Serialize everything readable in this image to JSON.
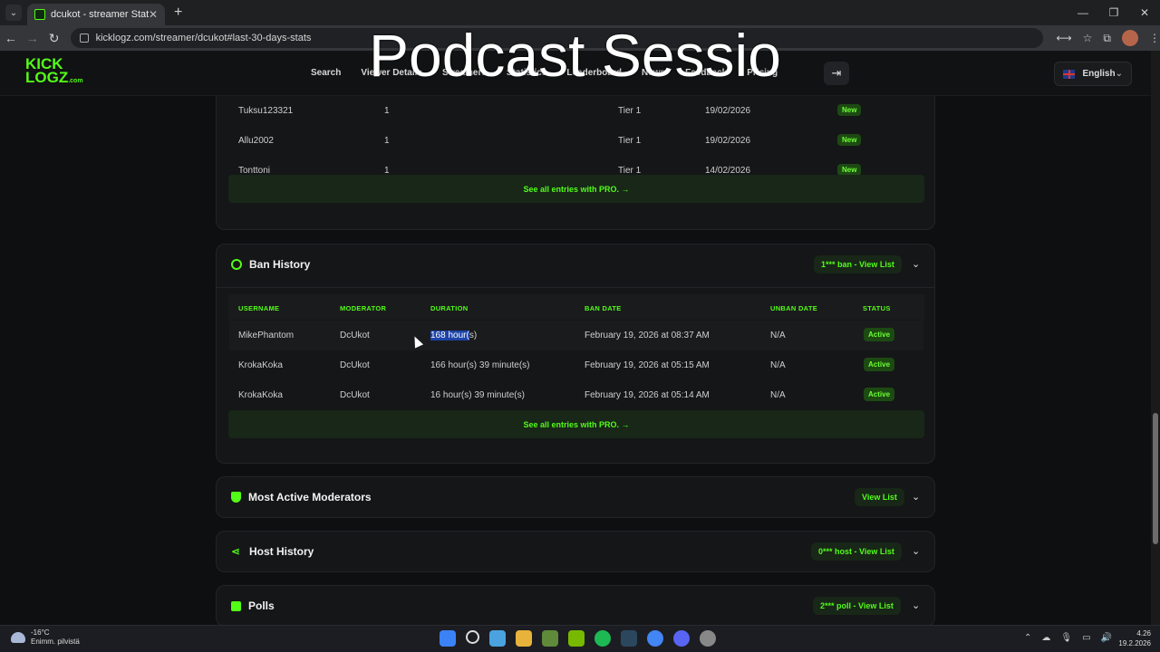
{
  "browser": {
    "tab_title": "dcukot - streamer Statistics",
    "url": "kicklogz.com/streamer/dcukot#last-30-days-stats"
  },
  "overlay": {
    "text": "Podcast Sessio"
  },
  "site": {
    "logo_top": "KICK",
    "logo_bottom": "LOGZ",
    "logo_suffix": ".com",
    "nav": [
      "Search",
      "Viewer Details",
      "Streamers",
      "Statistics",
      "Leaderboard",
      "News",
      "Feedback",
      "Pricing"
    ],
    "language": "English"
  },
  "subs_table": {
    "rows": [
      {
        "user": "Tuksu123321",
        "count": "1",
        "tier": "Tier 1",
        "date": "19/02/2026",
        "badge": "New"
      },
      {
        "user": "Allu2002",
        "count": "1",
        "tier": "Tier 1",
        "date": "19/02/2026",
        "badge": "New"
      },
      {
        "user": "Tonttoni",
        "count": "1",
        "tier": "Tier 1",
        "date": "14/02/2026",
        "badge": "New"
      }
    ],
    "see_all": "See all entries with PRO."
  },
  "ban_history": {
    "title": "Ban History",
    "pill": "1*** ban - View List",
    "headers": [
      "USERNAME",
      "MODERATOR",
      "DURATION",
      "BAN DATE",
      "UNBAN DATE",
      "STATUS"
    ],
    "rows": [
      {
        "user": "MikePhantom",
        "mod": "DcUkot",
        "duration_hl": "168 hour(",
        "duration_rest": "s)",
        "ban_date": "February 19, 2026 at 08:37 AM",
        "unban": "N/A",
        "status": "Active"
      },
      {
        "user": "KrokaKoka",
        "mod": "DcUkot",
        "duration_hl": "",
        "duration_rest": "166 hour(s) 39 minute(s)",
        "ban_date": "February 19, 2026 at 05:15 AM",
        "unban": "N/A",
        "status": "Active"
      },
      {
        "user": "KrokaKoka",
        "mod": "DcUkot",
        "duration_hl": "",
        "duration_rest": "16 hour(s) 39 minute(s)",
        "ban_date": "February 19, 2026 at 05:14 AM",
        "unban": "N/A",
        "status": "Active"
      }
    ],
    "see_all": "See all entries with PRO."
  },
  "sections": {
    "moderators": {
      "title": "Most Active Moderators",
      "pill": "View List"
    },
    "host": {
      "title": "Host History",
      "pill": "0*** host - View List"
    },
    "polls": {
      "title": "Polls",
      "pill": "2*** poll - View List"
    }
  },
  "taskbar": {
    "temp": "-16°C",
    "weather": "Enimm. pilvistä",
    "time": "4.26",
    "date": "19.2.2026"
  },
  "colors": {
    "accent": "#53fc18",
    "background": "#0e0f10",
    "card": "#151617"
  }
}
